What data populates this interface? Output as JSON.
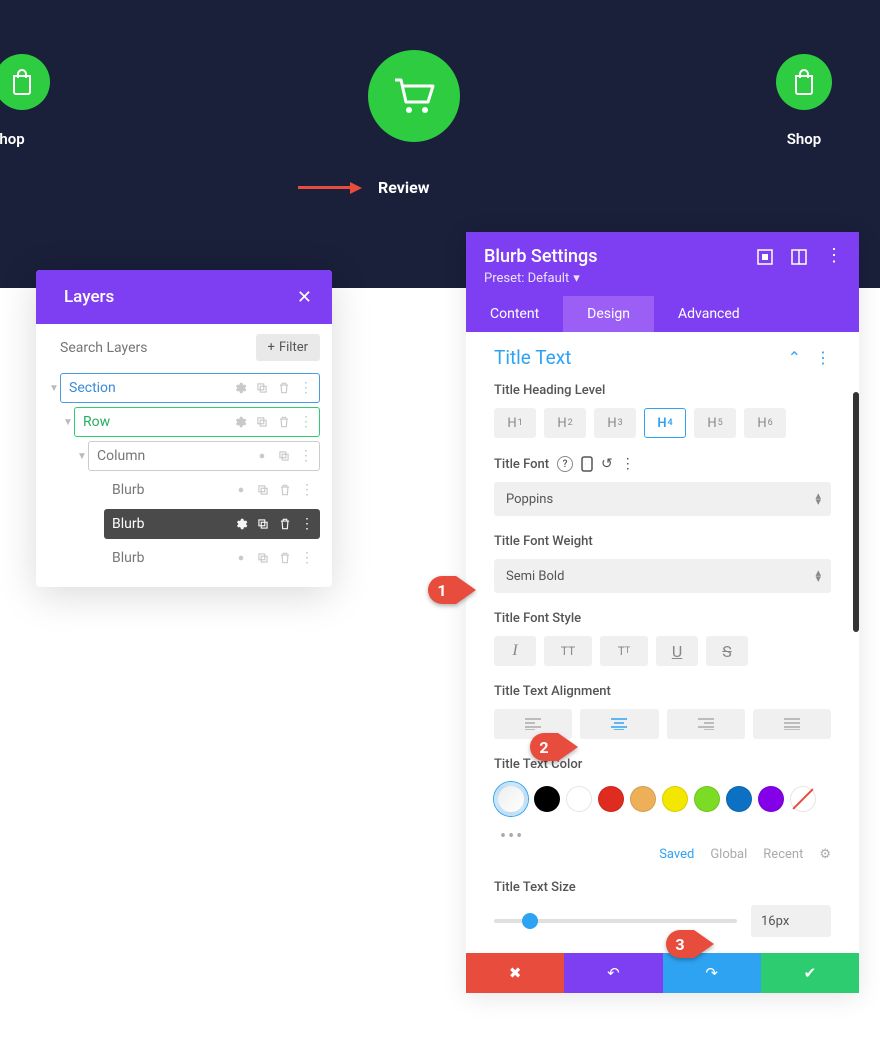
{
  "topbar": {
    "shop_left_label": "hop",
    "shop_right_label": "Shop",
    "review_label": "Review"
  },
  "layers": {
    "title": "Layers",
    "search_placeholder": "Search Layers",
    "filter_label": "Filter",
    "items": [
      {
        "label": "Section",
        "type": "section"
      },
      {
        "label": "Row",
        "type": "row"
      },
      {
        "label": "Column",
        "type": "column"
      },
      {
        "label": "Blurb"
      },
      {
        "label": "Blurb",
        "active": true
      },
      {
        "label": "Blurb"
      }
    ]
  },
  "settings": {
    "title": "Blurb Settings",
    "preset_label": "Preset: Default",
    "tabs": {
      "content": "Content",
      "design": "Design",
      "advanced": "Advanced"
    },
    "section_title": "Title Text",
    "labels": {
      "heading_level": "Title Heading Level",
      "font": "Title Font",
      "font_weight": "Title Font Weight",
      "font_style": "Title Font Style",
      "alignment": "Title Text Alignment",
      "color": "Title Text Color",
      "size": "Title Text Size"
    },
    "heading_levels": [
      "H1",
      "H2",
      "H3",
      "H4",
      "H5",
      "H6"
    ],
    "active_heading_level": "H4",
    "font_value": "Poppins",
    "font_weight_value": "Semi Bold",
    "colors": {
      "swatches": [
        "#000000",
        "#ffffff",
        "#e02b20",
        "#edb059",
        "#f3e600",
        "#7cdb24",
        "#0c71c3",
        "#8300e9"
      ],
      "tabs": {
        "saved": "Saved",
        "global": "Global",
        "recent": "Recent"
      }
    },
    "size_value": "16px"
  },
  "annotations": {
    "c1": "1",
    "c2": "2",
    "c3": "3"
  }
}
